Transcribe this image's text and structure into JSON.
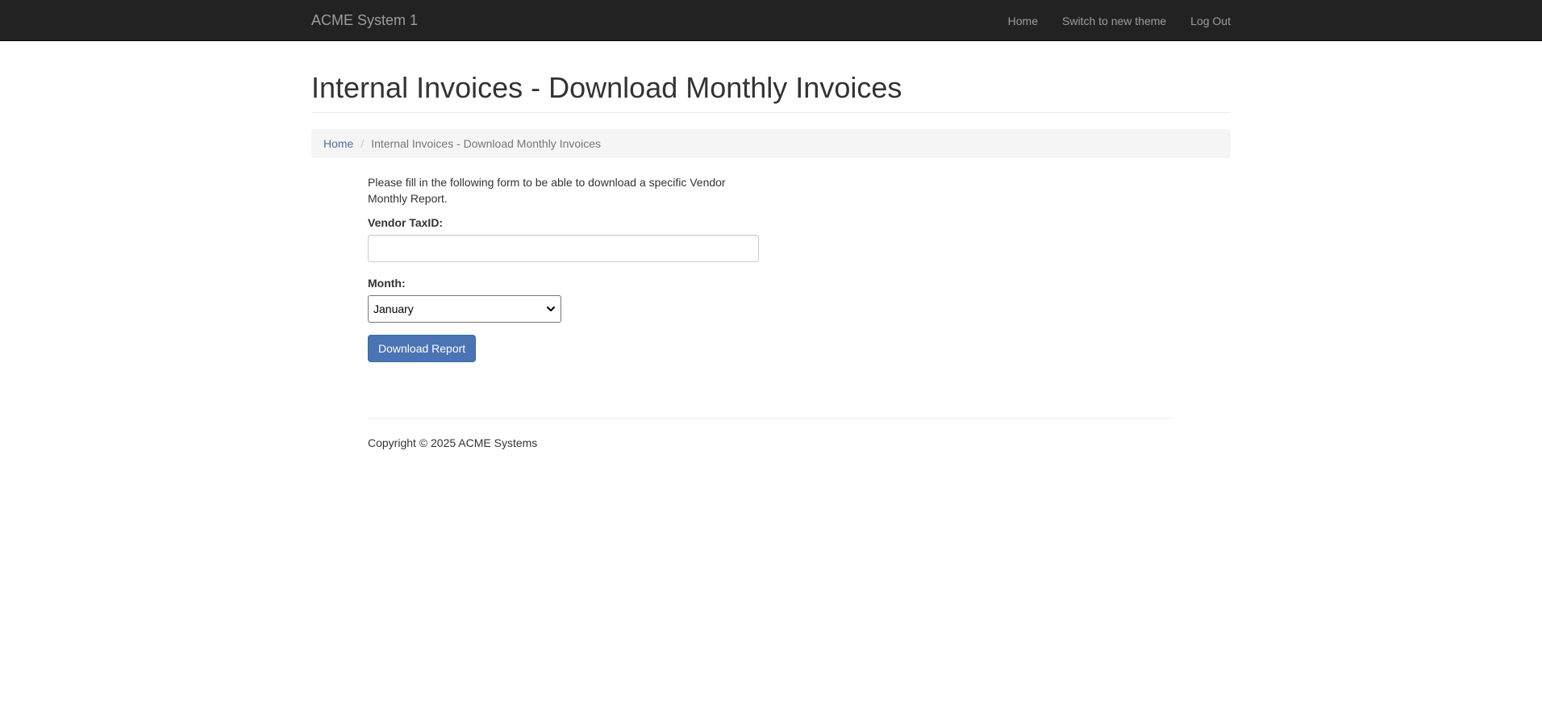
{
  "navbar": {
    "brand": "ACME System 1",
    "links": [
      "Home",
      "Switch to new theme",
      "Log Out"
    ]
  },
  "page": {
    "title": "Internal Invoices - Download Monthly Invoices"
  },
  "breadcrumb": {
    "home": "Home",
    "separator": "/",
    "current": "Internal Invoices - Download Monthly Invoices"
  },
  "form": {
    "intro": "Please fill in the following form to be able to download a specific Vendor Monthly Report.",
    "vendor_label": "Vendor TaxID:",
    "vendor_value": "",
    "month_label": "Month:",
    "month_selected": "January",
    "submit_label": "Download Report"
  },
  "footer": {
    "copyright": "Copyright © 2025 ACME Systems"
  },
  "colors": {
    "navbar_bg": "#222222",
    "link": "#4a6fa5",
    "primary_button": "#4a74b3"
  }
}
